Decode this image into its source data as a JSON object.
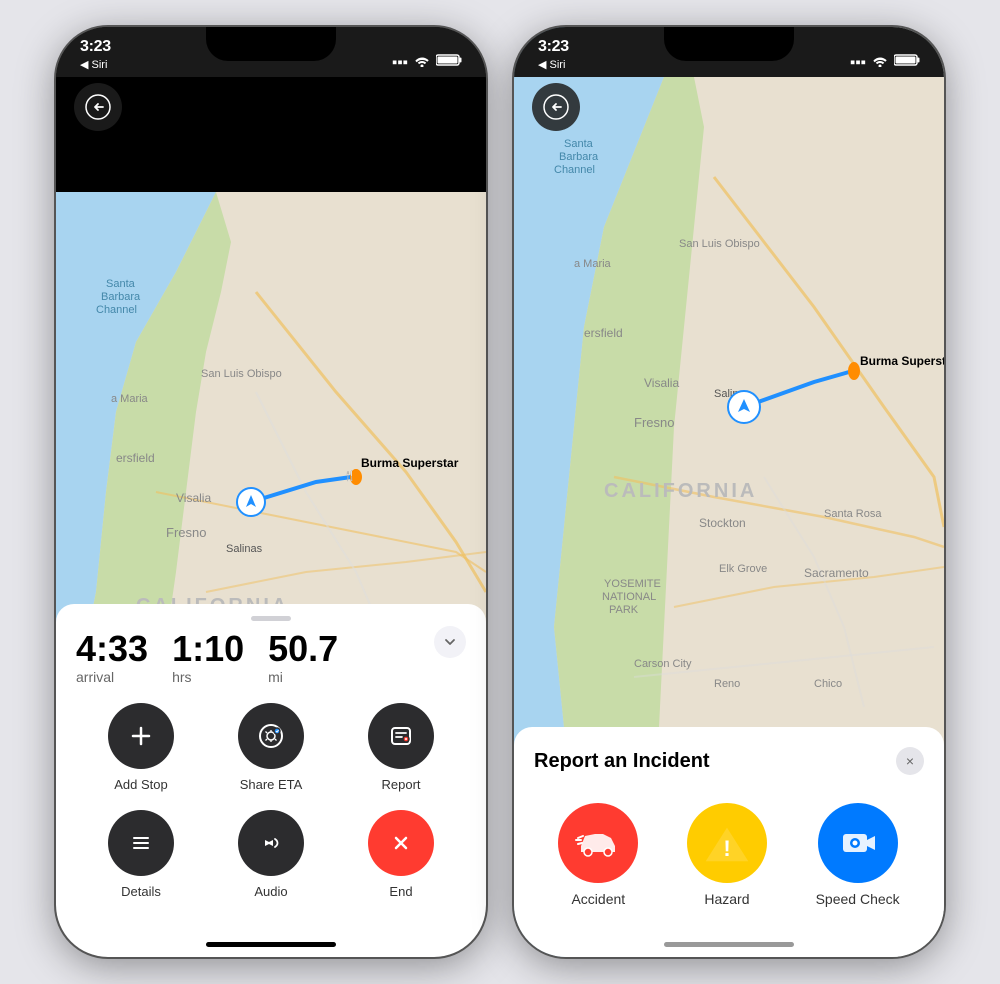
{
  "phones": [
    {
      "id": "phone1",
      "statusBar": {
        "time": "3:23",
        "arrow": "▶",
        "siri": "◀ Siri"
      },
      "map": {
        "destination": "Burma Superstar"
      },
      "navPanel": {
        "arrival": "4:33",
        "arrivalLabel": "arrival",
        "hours": "1:10",
        "hoursLabel": "hrs",
        "miles": "50.7",
        "milesLabel": "mi",
        "buttons": [
          {
            "icon": "+",
            "label": "Add Stop",
            "style": "dark"
          },
          {
            "icon": "share",
            "label": "Share ETA",
            "style": "dark"
          },
          {
            "icon": "report",
            "label": "Report",
            "style": "dark"
          },
          {
            "icon": "list",
            "label": "Details",
            "style": "dark"
          },
          {
            "icon": "audio",
            "label": "Audio",
            "style": "dark"
          },
          {
            "icon": "x",
            "label": "End",
            "style": "red"
          }
        ]
      }
    },
    {
      "id": "phone2",
      "statusBar": {
        "time": "3:23",
        "arrow": "▶",
        "siri": "◀ Siri"
      },
      "map": {
        "destination": "Burma Superstar"
      },
      "reportPanel": {
        "title": "Report an Incident",
        "closeLabel": "×",
        "buttons": [
          {
            "icon": "🚗",
            "label": "Accident",
            "style": "red"
          },
          {
            "icon": "⚠",
            "label": "Hazard",
            "style": "yellow"
          },
          {
            "icon": "📷",
            "label": "Speed Check",
            "style": "blue"
          }
        ]
      }
    }
  ]
}
